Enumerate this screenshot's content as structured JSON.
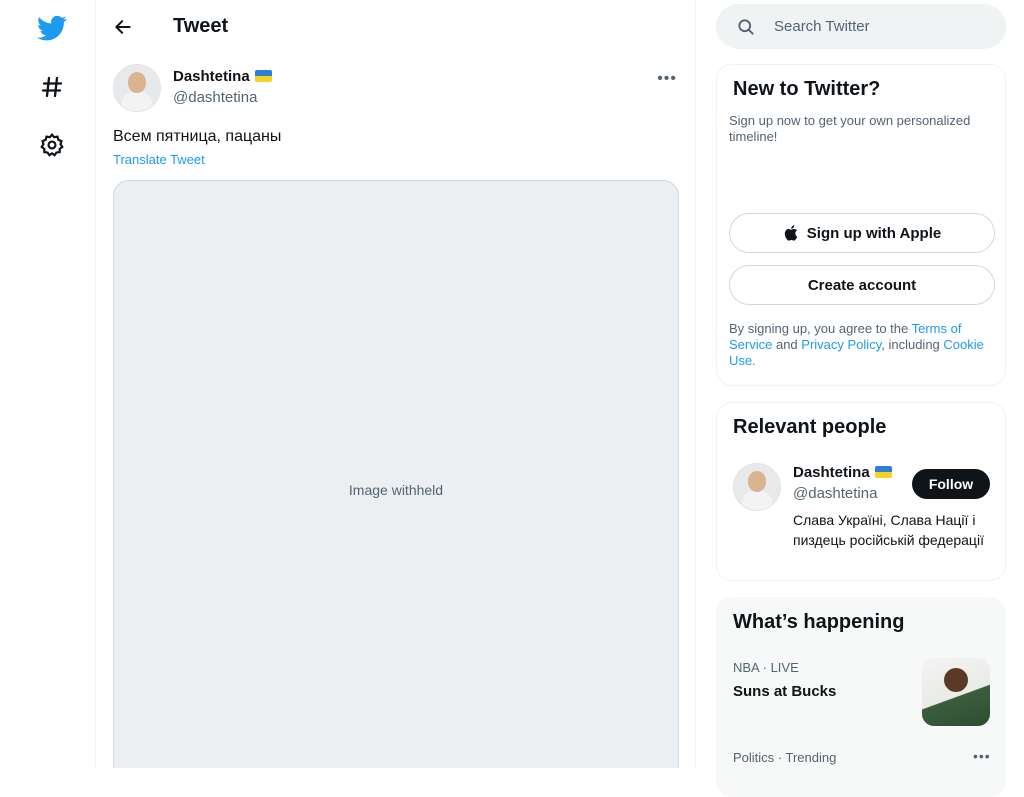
{
  "header": {
    "title": "Tweet"
  },
  "tweet": {
    "author_name": "Dashtetina",
    "author_handle": "@dashtetina",
    "text": "Всем пятница, пацаны",
    "translate_label": "Translate Tweet",
    "more": "•••"
  },
  "search": {
    "placeholder": "Search Twitter"
  },
  "signup": {
    "title": "New to Twitter?",
    "subtitle": "Sign up now to get your own personalized timeline!",
    "apple_label": "Sign up with Apple",
    "create_label": "Create account",
    "legal_prefix": "By signing up, you agree to the ",
    "terms_link": "Terms of Service",
    "legal_and": " and ",
    "privacy_link": "Privacy Policy",
    "legal_including": ", including ",
    "cookie_link": "Cookie Use."
  },
  "relevant": {
    "title": "Relevant people",
    "name": "Dashtetina",
    "handle": "@dashtetina",
    "follow_label": "Follow",
    "bio": "Слава Україні, Слава Нації і пиздець російській федерації"
  },
  "happening": {
    "title": "What’s happening",
    "items": [
      {
        "meta": "NBA · LIVE",
        "title": "Suns at Bucks"
      },
      {
        "meta": "Politics · Trending",
        "more": "•••"
      }
    ]
  },
  "colors": {
    "accent": "#1d9bf0",
    "text": "#0f1419",
    "muted": "#536471"
  },
  "icons": [
    "twitter-logo-icon",
    "hashtag-icon",
    "settings-icon",
    "back-arrow-icon",
    "more-icon",
    "search-icon",
    "apple-icon"
  ]
}
